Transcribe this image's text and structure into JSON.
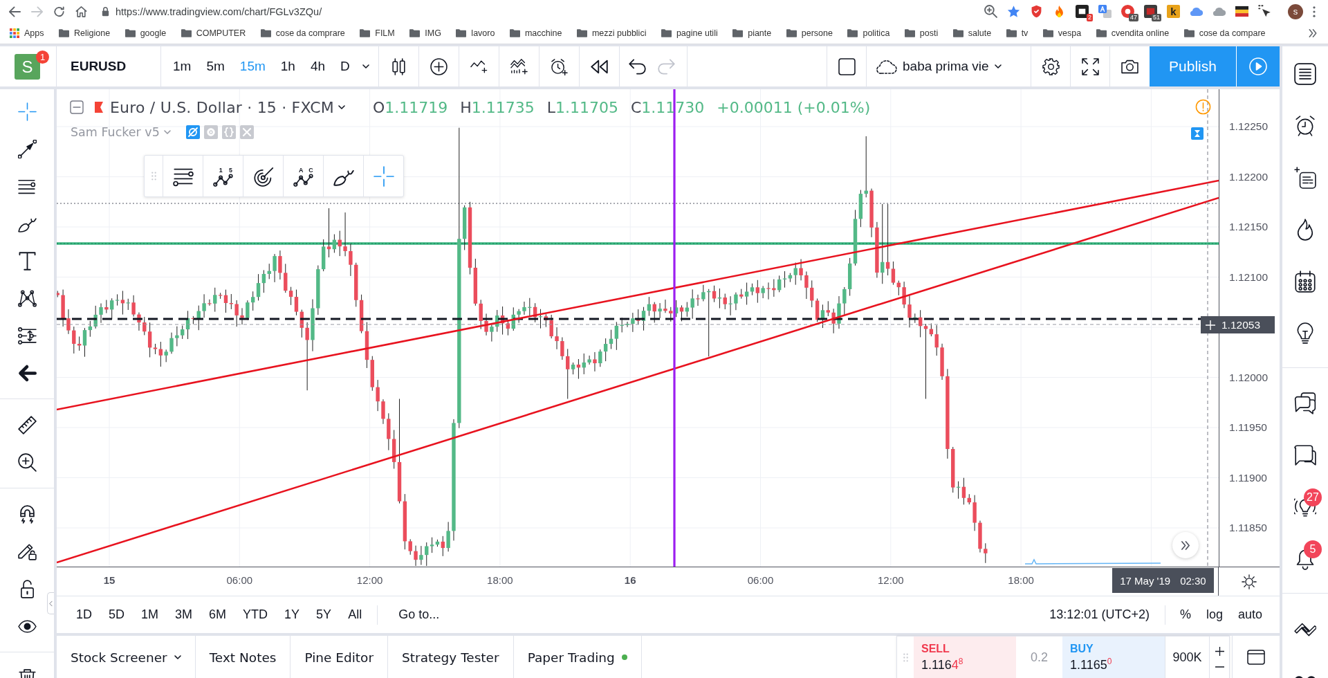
{
  "browser": {
    "navigation": [
      {
        "kind": "back",
        "disabled": false
      },
      {
        "kind": "forward",
        "disabled": true
      },
      {
        "kind": "reload",
        "disabled": false
      },
      {
        "kind": "home",
        "disabled": false
      }
    ],
    "url": "https://www.tradingview.com/chart/FGLv3ZQu/",
    "extension_badges": [
      "2",
      "47",
      "51"
    ],
    "extension_letter": "k",
    "profile": "s"
  },
  "bookmarks": {
    "apps": "Apps",
    "folders": [
      "Religione",
      "google",
      "COMPUTER",
      "cose da comprare",
      "FILM",
      "IMG",
      "lavoro",
      "macchine",
      "mezzi pubblici",
      "pagine utili",
      "piante",
      "persone",
      "politica",
      "posti",
      "salute",
      "tv",
      "vespa",
      "cvendita online",
      "cose da compare"
    ]
  },
  "header": {
    "avatar": "S",
    "notifications": "1",
    "symbol": "EURUSD",
    "intervals": [
      {
        "label": "1m",
        "selected": false
      },
      {
        "label": "5m",
        "selected": false
      },
      {
        "label": "15m",
        "selected": true
      },
      {
        "label": "1h",
        "selected": false
      },
      {
        "label": "4h",
        "selected": false
      },
      {
        "label": "D",
        "selected": false
      }
    ],
    "history": [
      {
        "kind": "undo",
        "disabled": false
      },
      {
        "kind": "redo",
        "disabled": true
      }
    ],
    "layout": "baba prima vie",
    "publish": "Publish"
  },
  "left_toolbar": {
    "groups": [
      [
        {
          "kind": "cross",
          "selected": true
        },
        {
          "kind": "trend",
          "selected": false
        },
        {
          "kind": "fib",
          "selected": false
        },
        {
          "kind": "brush",
          "selected": false
        },
        {
          "kind": "text",
          "selected": false
        },
        {
          "kind": "pattern",
          "selected": false
        },
        {
          "kind": "forecast",
          "selected": false
        },
        {
          "kind": "back",
          "selected": false
        }
      ],
      [
        {
          "kind": "ruler",
          "selected": false
        },
        {
          "kind": "zoom",
          "selected": false
        }
      ],
      [
        {
          "kind": "magnet"
        },
        {
          "kind": "pencil_lock"
        },
        {
          "kind": "lock"
        },
        {
          "kind": "eye"
        }
      ],
      [
        {
          "kind": "trash"
        }
      ]
    ]
  },
  "chart": {
    "legend": {
      "title": "Euro / U.S. Dollar · 15 · FXCM",
      "ohlc": [
        {
          "letter": "O",
          "value": "1.11719"
        },
        {
          "letter": "H",
          "value": "1.11735"
        },
        {
          "letter": "L",
          "value": "1.11705"
        },
        {
          "letter": "C",
          "value": "1.11730"
        }
      ],
      "change": "+0.00011 (+0.01%)"
    },
    "indicator": {
      "name": "Sam Fucker v5",
      "hidden": true
    },
    "drawing_toolbar": [
      {
        "kind": "lines",
        "selected": false
      },
      {
        "kind": "wave",
        "marks": [
          "1",
          "5"
        ],
        "selected": false
      },
      {
        "kind": "spiral",
        "selected": false
      },
      {
        "kind": "wave",
        "marks": [
          "A",
          "C"
        ],
        "selected": false
      },
      {
        "kind": "brush",
        "selected": false
      },
      {
        "kind": "cross",
        "selected": true
      }
    ],
    "price_ticks": [
      "1.12250",
      "1.12200",
      "1.12150",
      "1.12100",
      "1.12000",
      "1.11950",
      "1.11900",
      "1.11850"
    ],
    "last_price": "1.12053",
    "time_ticks": [
      {
        "label": "15",
        "day": true
      },
      {
        "label": "06:00",
        "day": false
      },
      {
        "label": "12:00",
        "day": false
      },
      {
        "label": "18:00",
        "day": false
      },
      {
        "label": "16",
        "day": true
      },
      {
        "label": "06:00",
        "day": false
      },
      {
        "label": "12:00",
        "day": false
      },
      {
        "label": "18:00",
        "day": false
      }
    ],
    "cursor_time": {
      "date": "17 May '19",
      "time": "02:30"
    }
  },
  "range_bar": {
    "ranges": [
      "1D",
      "5D",
      "1M",
      "3M",
      "6M",
      "YTD",
      "1Y",
      "5Y",
      "All"
    ],
    "go_to": "Go to...",
    "clock": "13:12:01 (UTC+2)",
    "scales": [
      "%",
      "log",
      "auto"
    ]
  },
  "bottom_panel": {
    "tabs": [
      {
        "label": "Stock Screener",
        "kind": "menu"
      },
      {
        "label": "Text Notes",
        "kind": "plain"
      },
      {
        "label": "Pine Editor",
        "kind": "plain"
      },
      {
        "label": "Strategy Tester",
        "kind": "plain"
      },
      {
        "label": "Paper Trading",
        "kind": "connected"
      }
    ],
    "trade": {
      "sell": {
        "label": "SELL",
        "price": "1.116",
        "pip": "4",
        "fraction": "8",
        "pip_highlighted": true
      },
      "spread": "0.2",
      "buy": {
        "label": "BUY",
        "price": "1.116",
        "pip": "5",
        "fraction": "0",
        "pip_highlighted": false
      },
      "quantity": "900K"
    }
  },
  "right_sidebar": {
    "groups": [
      [
        {
          "kind": "watchlist"
        },
        {
          "kind": "alerts"
        },
        {
          "kind": "ideas"
        },
        {
          "kind": "hotlist"
        },
        {
          "kind": "calendar"
        },
        {
          "kind": "bulb"
        }
      ],
      [
        {
          "kind": "chats"
        },
        {
          "kind": "chat"
        },
        {
          "kind": "streams",
          "badge": "27"
        },
        {
          "kind": "notifications",
          "badge": "5"
        }
      ],
      [
        {
          "kind": "collapse"
        },
        {
          "kind": "more"
        }
      ]
    ]
  }
}
